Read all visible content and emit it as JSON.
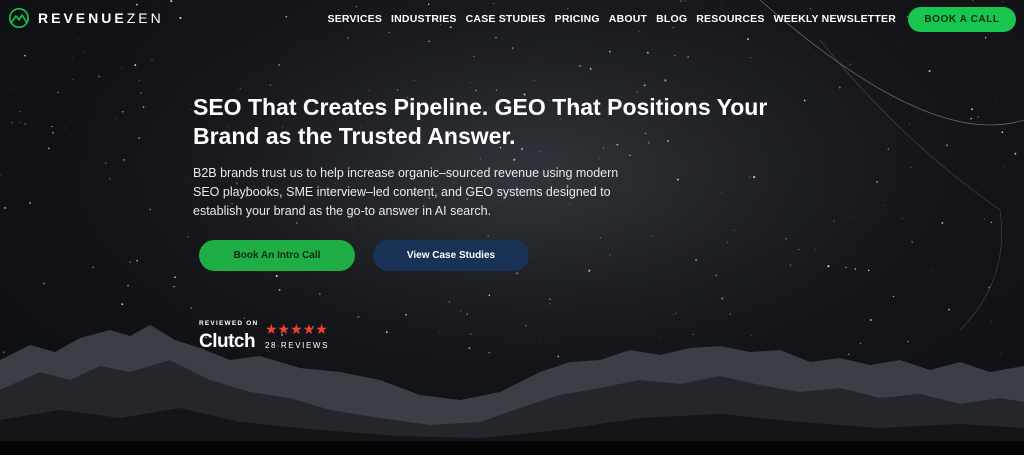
{
  "brand": {
    "logo_bold": "REVENUE",
    "logo_light": "ZEN",
    "accent_green": "#17c64e",
    "navy": "#183356",
    "star_red": "#ef4335"
  },
  "nav": {
    "items": [
      {
        "label": "SERVICES"
      },
      {
        "label": "INDUSTRIES"
      },
      {
        "label": "CASE STUDIES"
      },
      {
        "label": "PRICING"
      },
      {
        "label": "ABOUT"
      },
      {
        "label": "BLOG"
      },
      {
        "label": "RESOURCES"
      },
      {
        "label": "WEEKLY NEWSLETTER"
      }
    ],
    "cta_label": "BOOK A CALL"
  },
  "hero": {
    "title": "SEO That Creates Pipeline. GEO That Positions Your Brand as the Trusted Answer.",
    "subtitle": "B2B brands trust us to help increase organic–sourced revenue using modern SEO playbooks, SME interview–led content, and GEO systems designed to establish your brand as the go-to answer in AI search.",
    "primary_button": "Book An Intro Call",
    "secondary_button": "View Case Studies"
  },
  "clutch": {
    "reviewed_on": "REVIEWED ON",
    "logo_text": "Clutch",
    "stars": "★★★★★",
    "rating": 5,
    "review_count": "28 REVIEWS"
  }
}
